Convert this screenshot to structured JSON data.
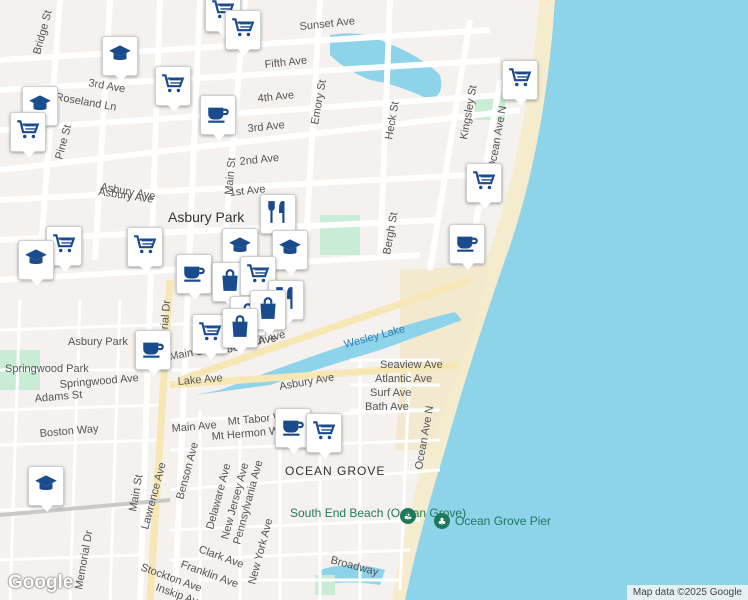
{
  "map": {
    "street_labels": [
      "Sunset Ave",
      "Fifth Ave",
      "4th Ave",
      "3rd Ave",
      "2nd Ave",
      "1st Ave",
      "Asbury Ave",
      "Bridge St",
      "3rd Ave",
      "Roseland Ln",
      "Pine St",
      "Emory St",
      "Heck St",
      "Bergh St",
      "Kingsley St",
      "Ocean Ave N",
      "Memorial Dr",
      "Main St",
      "Lake Ave",
      "Springwood Ave",
      "Adams St",
      "Boston Way",
      "Main Ave",
      "Mt Tabor Way",
      "Mt Hermon Way",
      "Asbury Ave",
      "Seaview Ave",
      "Atlantic Ave",
      "Surf Ave",
      "Bath Ave",
      "Ocean Ave N",
      "Benson Ave",
      "Lawrence Ave",
      "Delaware Ave",
      "New Jersey Ave",
      "Pennsylvania Ave",
      "New York Ave",
      "Clark Ave",
      "Franklin Ave",
      "Stockton Ave",
      "Inskip Ave",
      "Broadway",
      "Memorial Dr",
      "Main St",
      "Asbury Park",
      "Main St Cookman Ave",
      "Cookman Ave",
      "Asbury Ave"
    ],
    "city_label": "Asbury Park",
    "district_label": "OCEAN GROVE",
    "water_label": "Wesley Lake",
    "park_label": "Springwood Park",
    "pois": [
      "South End Beach (Ocean Grove)",
      "Ocean Grove Pier"
    ],
    "colors": {
      "ocean": "#8dd3ea",
      "land": "#f4f1ee",
      "road": "#ffffff",
      "beach": "#f5eccd",
      "park": "#c9ecd5",
      "marker_icon": "#1a4b8c",
      "poi": "#1f7a5c"
    }
  },
  "markers": [
    {
      "type": "grocery"
    },
    {
      "type": "grocery"
    },
    {
      "type": "school"
    },
    {
      "type": "grocery"
    },
    {
      "type": "school"
    },
    {
      "type": "grocery"
    },
    {
      "type": "cafe"
    },
    {
      "type": "grocery"
    },
    {
      "type": "grocery"
    },
    {
      "type": "cafe"
    },
    {
      "type": "grocery"
    },
    {
      "type": "school"
    },
    {
      "type": "grocery"
    },
    {
      "type": "restaurant"
    },
    {
      "type": "school"
    },
    {
      "type": "school"
    },
    {
      "type": "cafe"
    },
    {
      "type": "shopping"
    },
    {
      "type": "grocery"
    },
    {
      "type": "restaurant"
    },
    {
      "type": "shopping"
    },
    {
      "type": "shopping"
    },
    {
      "type": "grocery"
    },
    {
      "type": "shopping"
    },
    {
      "type": "cafe"
    },
    {
      "type": "cafe"
    },
    {
      "type": "grocery"
    },
    {
      "type": "school"
    }
  ],
  "branding": {
    "logo": "Google",
    "attribution": "Map data ©2025 Google"
  }
}
